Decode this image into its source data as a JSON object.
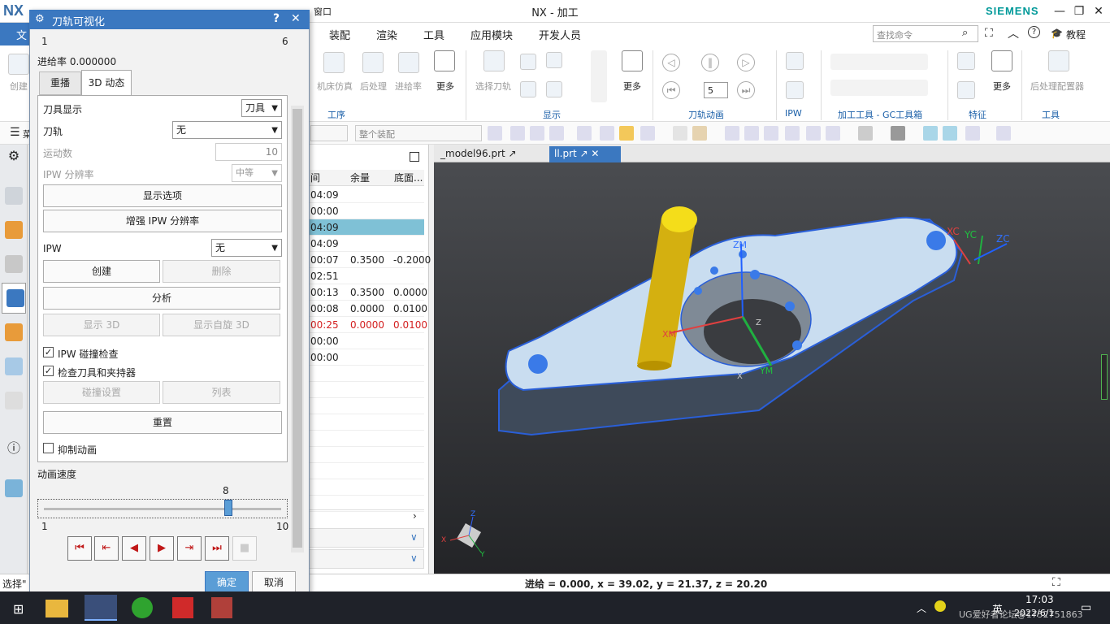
{
  "window": {
    "logo": "NX",
    "title": "NX - 加工",
    "brand": "SIEMENS",
    "menu_window": "窗口",
    "minimize": "—",
    "restore": "❐",
    "close": "✕"
  },
  "ribbon_tabs": [
    "文",
    "装配",
    "渲染",
    "工具",
    "应用模块",
    "开发人员"
  ],
  "search": {
    "placeholder": "查找命令",
    "tutorial": "教程"
  },
  "ribbon": {
    "labels": {
      "create": "创建",
      "machine_sim": "机床仿真",
      "postprocess": "后处理",
      "feed_rate": "进给率",
      "more1": "更多",
      "select_toolpath": "选择刀轨",
      "more2": "更多",
      "more3": "更多",
      "post_config": "后处理配置器",
      "speed_value": "5"
    },
    "groups": [
      "工序",
      "显示",
      "刀轨动画",
      "IPW",
      "加工工具 - GC工具箱",
      "特征",
      "工具"
    ]
  },
  "toolbar": {
    "menu_label": "菜",
    "assembly_combo": "整个装配"
  },
  "nav": {
    "headers": [
      "间",
      "余量",
      "底面..."
    ],
    "rows": [
      {
        "time": "04:09",
        "stock": "",
        "floor": "",
        "red": false,
        "selected": false
      },
      {
        "time": "00:00",
        "stock": "",
        "floor": "",
        "red": false,
        "selected": false
      },
      {
        "time": "04:09",
        "stock": "",
        "floor": "",
        "red": false,
        "selected": true
      },
      {
        "time": "04:09",
        "stock": "",
        "floor": "",
        "red": false,
        "selected": false
      },
      {
        "time": "00:07",
        "stock": "0.3500",
        "floor": "-0.2000",
        "red": false,
        "selected": false
      },
      {
        "time": "02:51",
        "stock": "",
        "floor": "",
        "red": false,
        "selected": false
      },
      {
        "time": "00:13",
        "stock": "0.3500",
        "floor": "0.0000",
        "red": false,
        "selected": false
      },
      {
        "time": "00:08",
        "stock": "0.0000",
        "floor": "0.0100",
        "red": false,
        "selected": false
      },
      {
        "time": "00:25",
        "stock": "0.0000",
        "floor": "0.0100",
        "red": true,
        "selected": false
      },
      {
        "time": "00:00",
        "stock": "",
        "floor": "",
        "red": false,
        "selected": false
      },
      {
        "time": "00:00",
        "stock": "",
        "floor": "",
        "red": false,
        "selected": false
      }
    ]
  },
  "doc_tabs": [
    "_model96.prt",
    "ll.prt"
  ],
  "axes": {
    "xc": "XC",
    "yc": "YC",
    "zc": "ZC",
    "zm": "ZM",
    "xm": "XM",
    "ym": "YM",
    "x": "X",
    "y": "Y",
    "z": "Z"
  },
  "dialog": {
    "title": "刀轨可视化",
    "help": "?",
    "close": "✕",
    "slider_min_top": "1",
    "slider_max_top": "6",
    "feed": "进给率 0.000000",
    "tabs": [
      "重播",
      "3D 动态"
    ],
    "tool_display_label": "刀具显示",
    "tool_display_value": "刀具",
    "toolpath_label": "刀轨",
    "toolpath_value": "无",
    "motion_count_label": "运动数",
    "motion_count_value": "10",
    "ipw_res_label": "IPW 分辨率",
    "ipw_res_value": "中等",
    "display_options": "显示选项",
    "enhance_ipw": "增强 IPW 分辨率",
    "ipw_label": "IPW",
    "ipw_value": "无",
    "create": "创建",
    "delete": "删除",
    "analyze": "分析",
    "show3d": "显示 3D",
    "show_spin3d": "显示自旋 3D",
    "ipw_collision": "IPW 碰撞检查",
    "check_tool": "检查刀具和夹持器",
    "collision_settings": "碰撞设置",
    "list": "列表",
    "reset": "重置",
    "suppress_anim": "抑制动画",
    "anim_speed_label": "动画速度",
    "speed_value": "8",
    "speed_min": "1",
    "speed_max": "10",
    "ok": "确定",
    "cancel": "取消"
  },
  "animation_speed": {
    "value": 8,
    "min": 1,
    "max": 10
  },
  "status": {
    "left": "选择\"",
    "readout": "进给 = 0.000, x = 39.02, y = 21.37, z = 20.20"
  },
  "taskbar": {
    "ime": "英",
    "time": "17:03",
    "date": "2022/6/1",
    "watermark": "UG爱好者论坛@1752751863"
  },
  "colors": {
    "accent": "#3b78c0",
    "selected_row": "#7fc1d6",
    "model": "#c7dcf0",
    "tool": "#e8c21a"
  }
}
